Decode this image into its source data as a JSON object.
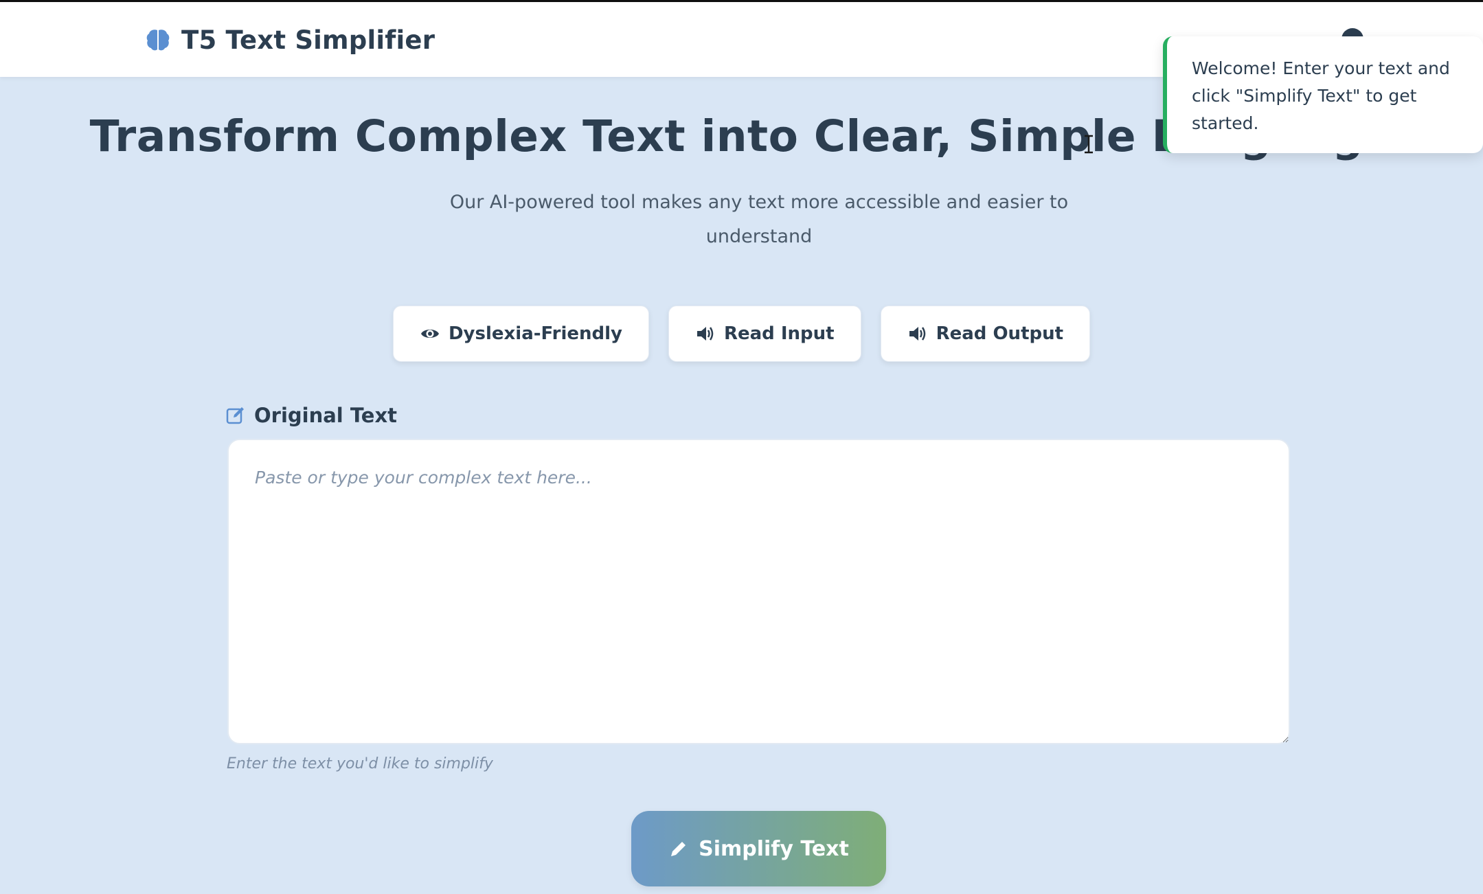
{
  "navbar": {
    "brand_icon": "brain-icon",
    "brand_text": "T5 Text Simplifier"
  },
  "hero": {
    "title": "Transform Complex Text into Clear, Simple Language",
    "subtitle": "Our AI-powered tool makes any text more accessible and easier to understand"
  },
  "accessibility": {
    "buttons": [
      {
        "icon": "eye-icon",
        "label": "Dyslexia-Friendly"
      },
      {
        "icon": "speaker-icon",
        "label": "Read Input"
      },
      {
        "icon": "speaker-icon",
        "label": "Read Output"
      }
    ]
  },
  "input": {
    "label": "Original Text",
    "label_icon": "edit-icon",
    "placeholder": "Paste or type your complex text here...",
    "value": "",
    "hint": "Enter the text you'd like to simplify"
  },
  "actions": {
    "simplify_label": "Simplify Text",
    "simplify_icon": "pencil-icon"
  },
  "toast": {
    "message": "Welcome! Enter your text and click \"Simplify Text\" to get started."
  },
  "colors": {
    "background": "#d9e6f5",
    "text_dark": "#2c3e50",
    "toast_accent": "#27ae60",
    "gradient_start": "#6d9ac8",
    "gradient_end": "#7fae77",
    "icon_blue": "#5b8fd1"
  }
}
